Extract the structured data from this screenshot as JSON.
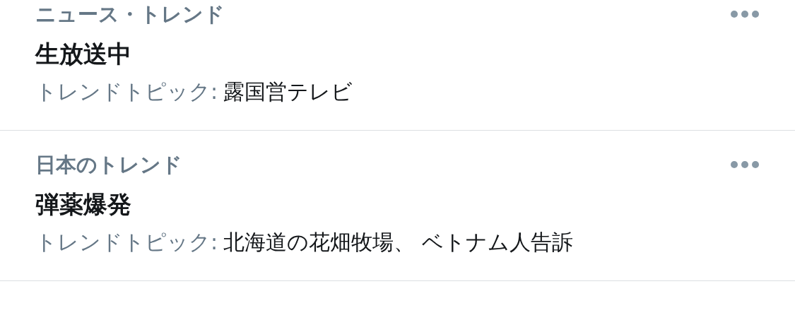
{
  "trends": [
    {
      "category": "ニュース・トレンド",
      "title": "生放送中",
      "topic_label": "トレンドトピック:",
      "topic_value": "露国営テレビ"
    },
    {
      "category": "日本のトレンド",
      "title": "弾薬爆発",
      "topic_label": "トレンドトピック:",
      "topic_value": "北海道の花畑牧場、 ベトナム人告訴"
    }
  ]
}
